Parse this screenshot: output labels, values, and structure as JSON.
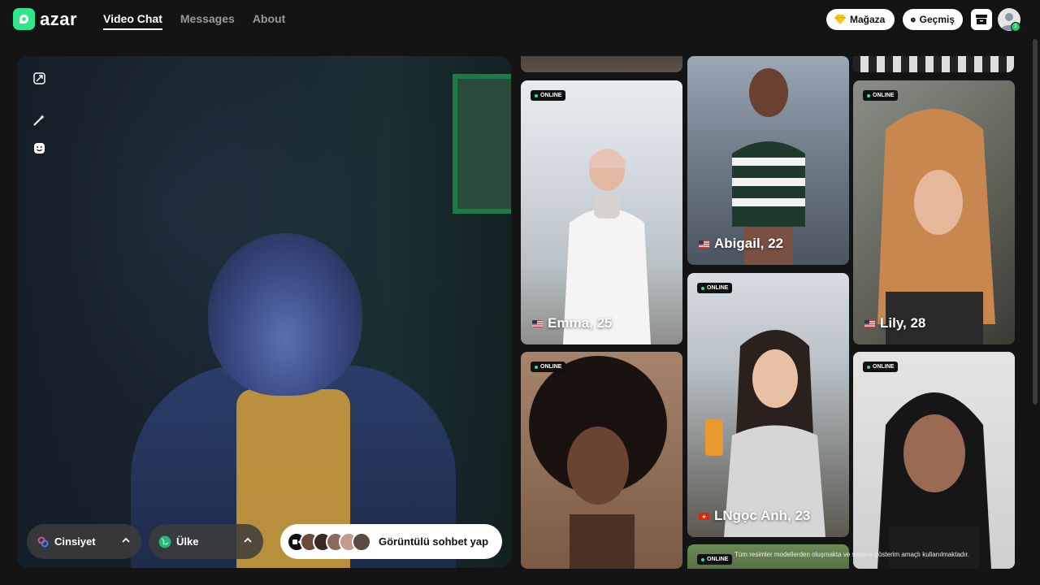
{
  "header": {
    "logo_text": "azar",
    "nav": [
      {
        "label": "Video Chat",
        "active": true
      },
      {
        "label": "Messages",
        "active": false
      },
      {
        "label": "About",
        "active": false
      }
    ],
    "store_label": "Mağaza",
    "history_label": "Geçmiş",
    "notification_count": "1"
  },
  "controls": {
    "gender_label": "Cinsiyet",
    "country_label": "Ülke",
    "start_label": "Görüntülü sohbet yap"
  },
  "gallery": {
    "badge": "ONLINE",
    "cards": [
      {
        "name": "Emma, 25",
        "country": "US"
      },
      {
        "name": "Abigail, 22",
        "country": "US"
      },
      {
        "name": "Lily, 28",
        "country": "US"
      },
      {
        "name": "LNgọc Anh, 23",
        "country": "VN"
      }
    ],
    "disclaimer": "Tüm resimler modellerden oluşmakta ve sadece gösterim amaçlı kullanılmaktadır."
  },
  "colors": {
    "brand": "#2fe68a",
    "background": "#141414"
  }
}
